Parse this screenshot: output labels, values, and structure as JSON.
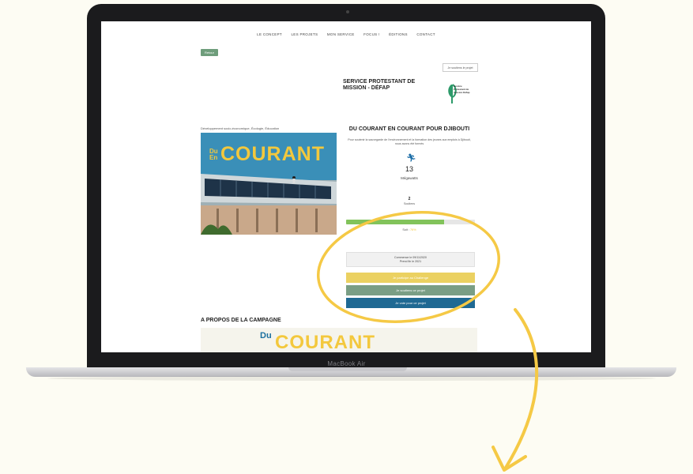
{
  "laptop": {
    "model_label": "MacBook Air"
  },
  "nav": {
    "items": [
      "LE CONCEPT",
      "LES PROJETS",
      "MON SERVICE",
      "FOCUS !",
      "ÉDITIONS",
      "CONTACT"
    ]
  },
  "page": {
    "back_label": "Retour",
    "donor_label": "Je soutiens le projet",
    "org_name": "SERVICE PROTESTANT DE MISSION - DÉFAP",
    "org_logo_text": "Service Protestant de mission Défap",
    "category": "Développement socio-économique, Écologie, Éducation",
    "image_caption_du": "Du",
    "image_caption_en": "En",
    "image_caption_courant": "COURANT",
    "project_title": "DU COURANT EN COURANT POUR DJIBOUTI",
    "project_desc": "Pour soutenir la sauvegarde de l'environnement et la formation des jeunes aux emplois à Djibouti, nous avons été formés",
    "stat_icon": "runner-icon",
    "stat_count": "13",
    "stat_label": "Mégawatts",
    "supporters_count": "2",
    "supporters_label": "Soutiens",
    "progress_label": "",
    "progress_percent": 76,
    "goal_prefix": "Soit :",
    "goal_value": "76%",
    "dates_line1": "Commence le 09/11/2020",
    "dates_line2": "Prend fin le 2021",
    "btn_participate": "Je participe au Challenge",
    "btn_support": "Je soutiens ce projet",
    "btn_vote": "Je vote pour ce projet",
    "about_title": "A PROPOS DE LA CAMPAGNE",
    "banner_du": "Du",
    "banner_courant": "COURANT"
  },
  "colors": {
    "accent_yellow": "#f3c83d",
    "green_button": "#7a9e85",
    "blue_button": "#1f6993",
    "progress_green": "#82c35b"
  }
}
